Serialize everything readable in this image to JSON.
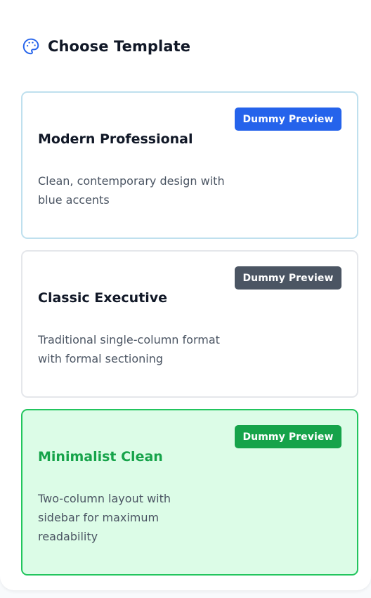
{
  "header": {
    "title": "Choose Template",
    "icon": "palette-icon",
    "icon_color": "#2563eb"
  },
  "templates": [
    {
      "name": "Modern Professional",
      "description": "Clean, contemporary design with blue accents",
      "preview_label": "Dummy Preview",
      "badge_color": "#2563eb",
      "selected": false
    },
    {
      "name": "Classic Executive",
      "description": "Traditional single-column format with formal sectioning",
      "preview_label": "Dummy Preview",
      "badge_color": "#4b5563",
      "selected": false
    },
    {
      "name": "Minimalist Clean",
      "description": "Two-column layout with sidebar for maximum readability",
      "preview_label": "Dummy Preview",
      "badge_color": "#16a34a",
      "name_color": "#16a34a",
      "selected": true
    }
  ]
}
